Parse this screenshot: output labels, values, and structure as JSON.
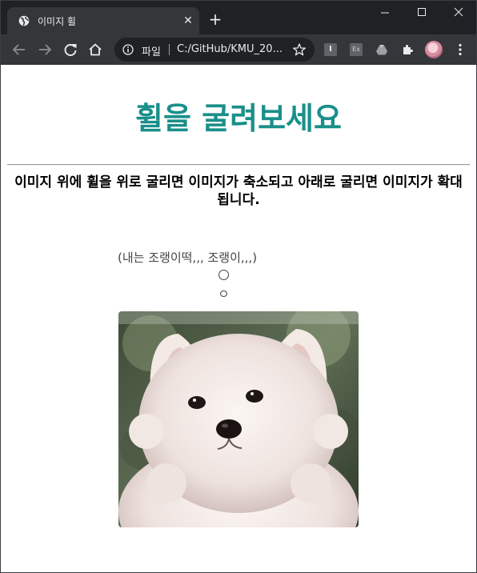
{
  "browser": {
    "tab": {
      "title": "이미지 휠",
      "close_glyph": "✕"
    },
    "new_tab_glyph": "+",
    "omnibox": {
      "scheme_label": "파일",
      "url": "C:/GitHub/KMU_20..."
    },
    "extensions": [
      {
        "name": "ext-i",
        "label": "I"
      },
      {
        "name": "ext-ex",
        "label": "Ex"
      }
    ]
  },
  "page": {
    "title": "휠을 굴려보세요",
    "description": "이미지 위에 휠을 위로 굴리면 이미지가 축소되고 아래로 굴리면 이미지가 확대됩니다.",
    "thought_text": "(내는 조랭이떡,,, 조랭이,,,)"
  },
  "colors": {
    "title": "#1a8f8a",
    "tabstrip": "#202124",
    "toolbar": "#35363a"
  }
}
